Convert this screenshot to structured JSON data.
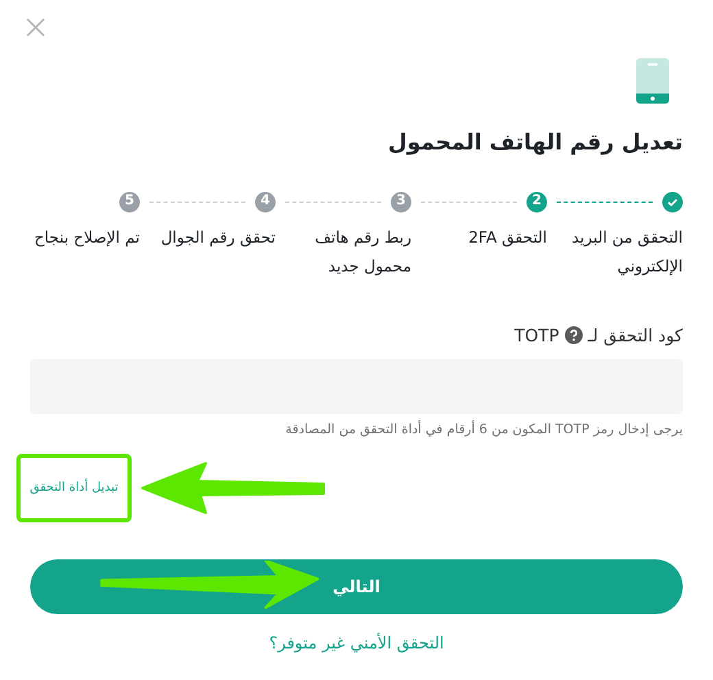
{
  "title": "تعديل رقم الهاتف المحمول",
  "steps": [
    {
      "label": "التحقق من البريد الإلكتروني",
      "done": true
    },
    {
      "label": "التحقق 2FA",
      "done": false,
      "current": true,
      "number": "2"
    },
    {
      "label": "ربط رقم هاتف محمول جديد",
      "done": false,
      "current": false,
      "number": "3"
    },
    {
      "label": "تحقق رقم الجوال",
      "done": false,
      "current": false,
      "number": "4"
    },
    {
      "label": "تم الإصلاح بنجاح",
      "done": false,
      "current": false,
      "number": "5"
    }
  ],
  "field": {
    "label_before": "كود التحقق لـ",
    "label_after": "TOTP",
    "hint": "يرجى إدخال رمز TOTP المكون من 6 أرقام في أداة التحقق من المصادقة"
  },
  "switch_link": {
    "label": "تبديل أداة التحقق",
    "framed": true,
    "arrow": true
  },
  "next_button": {
    "label": "التالي",
    "arrow": true
  },
  "help_link": {
    "label": "التحقق الأمني غير متوفر؟"
  }
}
